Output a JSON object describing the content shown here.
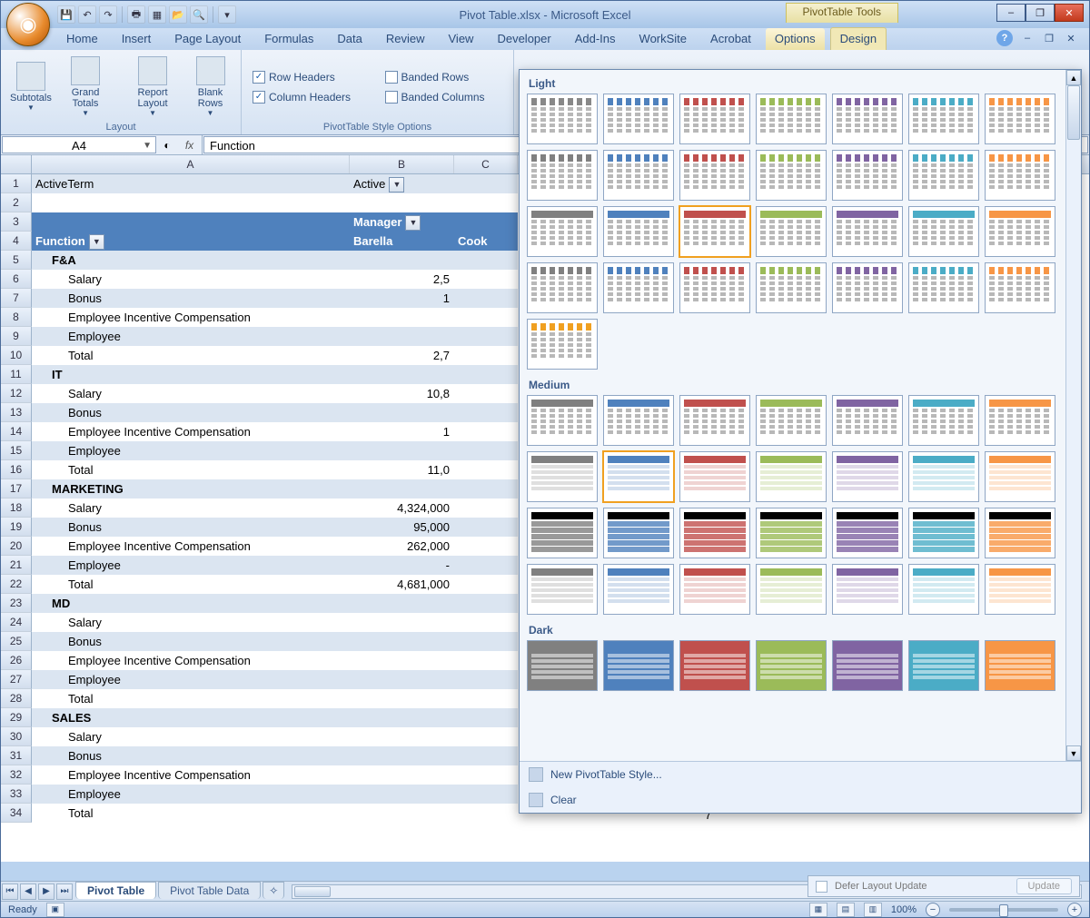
{
  "title": "Pivot Table.xlsx - Microsoft Excel",
  "contextual_tab": "PivotTable Tools",
  "qa_buttons": [
    "save-icon",
    "undo-icon",
    "redo-icon",
    "print-preview-icon",
    "new-icon",
    "open-icon",
    "print-icon"
  ],
  "win_controls": {
    "min": "–",
    "max": "❐",
    "close": "✕"
  },
  "tabs": [
    "Home",
    "Insert",
    "Page Layout",
    "Formulas",
    "Data",
    "Review",
    "View",
    "Developer",
    "Add-Ins",
    "WorkSite",
    "Acrobat"
  ],
  "ctx_tabs": [
    "Options",
    "Design"
  ],
  "active_ctx_tab": "Design",
  "ribbon": {
    "layout_group": "Layout",
    "buttons": [
      {
        "label": "Subtotals",
        "drop": true
      },
      {
        "label": "Grand\nTotals",
        "drop": true
      },
      {
        "label": "Report\nLayout",
        "drop": true
      },
      {
        "label": "Blank\nRows",
        "drop": true
      }
    ],
    "styleopts_group": "PivotTable Style Options",
    "options": [
      {
        "label": "Row Headers",
        "checked": true
      },
      {
        "label": "Column Headers",
        "checked": true
      },
      {
        "label": "Banded Rows",
        "checked": false
      },
      {
        "label": "Banded Columns",
        "checked": false
      }
    ]
  },
  "namebox": "A4",
  "formula": "Function",
  "columns": [
    "A",
    "B",
    "C"
  ],
  "pivot_hdr": {
    "active_term": "ActiveTerm",
    "active_val": "Active",
    "manager": "Manager",
    "function": "Function",
    "barella": "Barella",
    "cook": "Cook"
  },
  "rows": [
    {
      "n": 1,
      "a": "ActiveTerm",
      "b": "Active",
      "filter": true,
      "band": true
    },
    {
      "n": 2
    },
    {
      "n": 3,
      "a": "",
      "b": "Manager",
      "dropdown": true,
      "blue": true
    },
    {
      "n": 4,
      "a": "Function",
      "adrop": true,
      "b": "Barella",
      "c": "Cook",
      "blue": true
    },
    {
      "n": 5,
      "a": "F&A",
      "section": true,
      "band": true
    },
    {
      "n": 6,
      "a": "Salary",
      "b": "2,5",
      "indent": 2
    },
    {
      "n": 7,
      "a": "Bonus",
      "b": "1",
      "indent": 2,
      "band": true
    },
    {
      "n": 8,
      "a": "Employee Incentive Compensation",
      "indent": 2
    },
    {
      "n": 9,
      "a": "Employee",
      "indent": 2,
      "band": true
    },
    {
      "n": 10,
      "a": "Total",
      "b": "2,7",
      "indent": 2
    },
    {
      "n": 11,
      "a": "IT",
      "section": true,
      "band": true
    },
    {
      "n": 12,
      "a": "Salary",
      "b": "10,8",
      "indent": 2
    },
    {
      "n": 13,
      "a": "Bonus",
      "indent": 2,
      "band": true
    },
    {
      "n": 14,
      "a": "Employee Incentive Compensation",
      "b": "1",
      "indent": 2
    },
    {
      "n": 15,
      "a": "Employee",
      "indent": 2,
      "band": true
    },
    {
      "n": 16,
      "a": "Total",
      "b": "11,0",
      "indent": 2
    },
    {
      "n": 17,
      "a": "MARKETING",
      "section": true,
      "band": true
    },
    {
      "n": 18,
      "a": "Salary",
      "b": "4,324,000",
      "indent": 2
    },
    {
      "n": 19,
      "a": "Bonus",
      "b": "95,000",
      "indent": 2,
      "band": true
    },
    {
      "n": 20,
      "a": "Employee Incentive Compensation",
      "b": "262,000",
      "indent": 2
    },
    {
      "n": 21,
      "a": "Employee",
      "b": "-",
      "indent": 2,
      "band": true
    },
    {
      "n": 22,
      "a": "Total",
      "b": "4,681,000",
      "indent": 2
    },
    {
      "n": 23,
      "a": "MD",
      "section": true,
      "band": true
    },
    {
      "n": 24,
      "a": "Salary",
      "indent": 2
    },
    {
      "n": 25,
      "a": "Bonus",
      "indent": 2,
      "band": true
    },
    {
      "n": 26,
      "a": "Employee Incentive Compensation",
      "indent": 2
    },
    {
      "n": 27,
      "a": "Employee",
      "indent": 2,
      "band": true
    },
    {
      "n": 28,
      "a": "Total",
      "indent": 2
    },
    {
      "n": 29,
      "a": "SALES",
      "section": true,
      "band": true
    },
    {
      "n": 30,
      "a": "Salary",
      "indent": 2
    },
    {
      "n": 31,
      "a": "Bonus",
      "indent": 2,
      "band": true
    },
    {
      "n": 32,
      "a": "Employee Incentive Compensation",
      "indent": 2
    },
    {
      "n": 33,
      "a": "Employee",
      "indent": 2,
      "band": true
    },
    {
      "n": 34,
      "a": "Total",
      "indent": 2
    }
  ],
  "sheet_tabs": [
    "Pivot Table",
    "Pivot Table Data"
  ],
  "active_sheet": "Pivot Table",
  "status_ready": "Ready",
  "zoom": "100%",
  "taskpane": {
    "defer": "Defer Layout Update",
    "update": "Update"
  },
  "num_hint": "7",
  "gallery": {
    "sections": [
      "Light",
      "Medium",
      "Dark"
    ],
    "new_style": "New PivotTable Style...",
    "clear": "Clear",
    "colors": [
      "#808080",
      "#4f81bd",
      "#c0504d",
      "#9bbb59",
      "#8064a2",
      "#4bacc6",
      "#f79646"
    ]
  }
}
